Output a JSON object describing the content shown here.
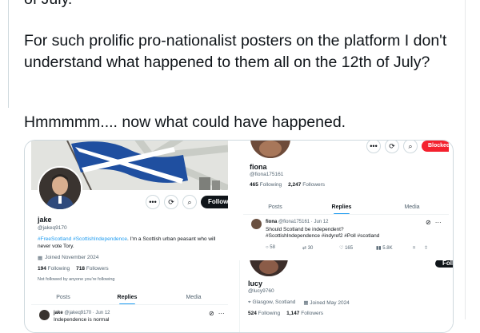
{
  "tweet": {
    "line0": "of July.",
    "para1": "For such prolific pro-nationalist posters on the platform I don't understand what happened to them all on the 12th of July?",
    "para2": "Hmmmmm.... now what could have happened."
  },
  "jake": {
    "name": "jake",
    "handle": "@jakeq9170",
    "follow_label": "Follow",
    "bio_tags": "#FreeScotland #ScottishIndependence",
    "bio_text": ". I'm a Scottish urban peasant who will never vote Tory.",
    "joined": "Joined November 2024",
    "following_count": "194",
    "following_label": "Following",
    "followers_count": "718",
    "followers_label": "Followers",
    "not_followed": "Not followed by anyone you're following",
    "tabs": [
      "Posts",
      "Replies",
      "Media"
    ],
    "post_header_name": "jake",
    "post_header_rest": "@jakeq9170 · Jun 12",
    "post_text": "Independence is normal"
  },
  "fiona": {
    "name": "fiona",
    "handle": "@fiona175161",
    "blocked_label": "Blocked",
    "following_count": "465",
    "following_label": "Following",
    "followers_count": "2,247",
    "followers_label": "Followers",
    "tabs": [
      "Posts",
      "Replies",
      "Media"
    ],
    "post_header_name": "fiona",
    "post_header_rest": "@fiona175161 · Jun 12",
    "post_text": "Should Scotland be independent?",
    "post_tags": "#ScottishIndependence #indyref2 #Poll #scotland",
    "replies": "58",
    "reposts": "30",
    "likes": "165",
    "views": "5.8K"
  },
  "lucy": {
    "name": "lucy",
    "handle": "@lucy9760",
    "follow_label": "Follow",
    "location": "Glasgow, Scotland",
    "joined": "Joined May 2024",
    "following_count": "524",
    "following_label": "Following",
    "followers_count": "1,147",
    "followers_label": "Followers"
  },
  "icons": [
    "more-icon",
    "refresh-icon",
    "search-icon",
    "reply-icon",
    "repost-icon",
    "like-icon",
    "views-icon",
    "bookmark-icon",
    "share-icon",
    "calendar-icon",
    "location-icon"
  ],
  "colors": {
    "accent": "#1d9bf0",
    "blocked": "#f4212e",
    "text": "#0f1419",
    "muted": "#536471",
    "flag_blue": "#1f4fa0"
  }
}
